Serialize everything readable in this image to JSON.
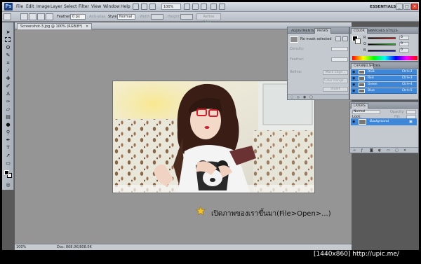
{
  "menubar": {
    "logo": "Ps",
    "items": [
      "File",
      "Edit",
      "Image",
      "Layer",
      "Select",
      "Filter",
      "View",
      "Window",
      "Help"
    ],
    "zoom": "100%",
    "workspace": "ESSENTIALS",
    "window_controls": [
      "_",
      "□",
      "×"
    ]
  },
  "options_bar": {
    "feather_label": "Feather:",
    "feather_value": "0 px",
    "anti_alias_label": "Anti-alias",
    "style_label": "Style:",
    "style_value": "Normal",
    "width_label": "Width:",
    "height_label": "Height:",
    "refine_edge": "Refine Edge..."
  },
  "document": {
    "tab_title": "Screenshot-3.jpg @ 100% (RGB/8*)",
    "tab_close": "×",
    "status_zoom": "100%",
    "status_doc": "Doc: 808.0K/808.0K"
  },
  "caption": "เปิดภาพของเราขึ้นมา(File>Open>...)",
  "adjustments_panel": {
    "tabs": [
      "ADJUSTMENTS",
      "MASKS"
    ],
    "no_mask": "No mask selected",
    "density_label": "Density:",
    "feather_label": "Feather:",
    "refine_label": "Refine:",
    "mask_edge": "Mask Edge...",
    "color_range": "Color Range...",
    "invert": "Invert"
  },
  "color_panel": {
    "tabs": [
      "COLOR",
      "SWATCHES",
      "STYLES"
    ],
    "channels": [
      {
        "label": "R",
        "value": "0",
        "color": "#d33"
      },
      {
        "label": "G",
        "value": "0",
        "color": "#3b3"
      },
      {
        "label": "B",
        "value": "0",
        "color": "#33d"
      }
    ]
  },
  "channels_panel": {
    "tabs": [
      "CHANNELS",
      "PATHS"
    ],
    "rows": [
      {
        "name": "RGB",
        "shortcut": "Ctrl+2"
      },
      {
        "name": "Red",
        "shortcut": "Ctrl+3"
      },
      {
        "name": "Green",
        "shortcut": "Ctrl+4"
      },
      {
        "name": "Blue",
        "shortcut": "Ctrl+5"
      }
    ]
  },
  "layers_panel": {
    "tabs": [
      "LAYERS"
    ],
    "blend_mode": "Normal",
    "opacity_label": "Opacity:",
    "lock_label": "Lock:",
    "fill_label": "Fill:",
    "layer_name": "Background",
    "footer_icons": [
      "link-icon",
      "fx-icon",
      "mask-icon",
      "adjustment-icon",
      "folder-icon",
      "new-layer-icon",
      "trash-icon"
    ]
  },
  "watermark": "[1440x860] http://upic.me/",
  "colors": {
    "app_bg": "#595959",
    "doc_bg": "#959595",
    "panel_bg": "#c4c9cf",
    "selection": "#3d86d8"
  }
}
